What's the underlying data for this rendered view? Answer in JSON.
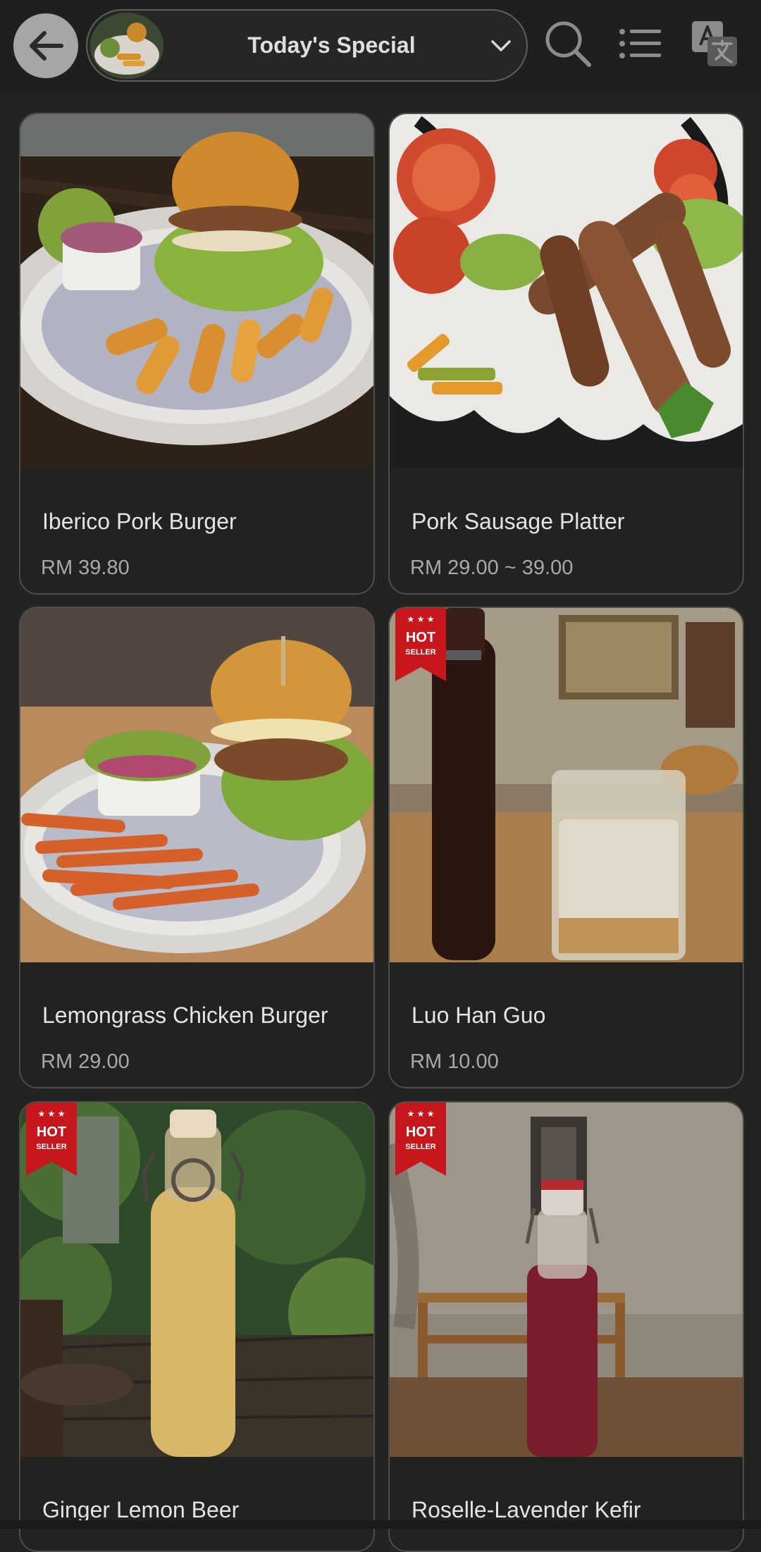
{
  "header": {
    "title": "Today's Special",
    "back_icon": "arrow-left-icon",
    "search_icon": "search-icon",
    "list_icon": "list-view-icon",
    "translate_icon": "translate-icon"
  },
  "badge": {
    "line1": "HOT",
    "line2": "SELLER"
  },
  "items": [
    {
      "name": "Iberico Pork Burger",
      "price": "RM 39.80",
      "hot": false
    },
    {
      "name": "Pork Sausage Platter",
      "price": "RM 29.00 ~ 39.00",
      "hot": false
    },
    {
      "name": "Lemongrass Chicken Burger",
      "price": "RM 29.00",
      "hot": false
    },
    {
      "name": "Luo Han Guo",
      "price": "RM 10.00",
      "hot": true
    },
    {
      "name": "Ginger Lemon Beer",
      "price": "",
      "hot": true
    },
    {
      "name": "Roselle-Lavender Kefir",
      "price": "",
      "hot": true
    }
  ],
  "colors": {
    "background": "#232321",
    "card_border": "#4d4d4a",
    "badge_red": "#c8161d"
  }
}
